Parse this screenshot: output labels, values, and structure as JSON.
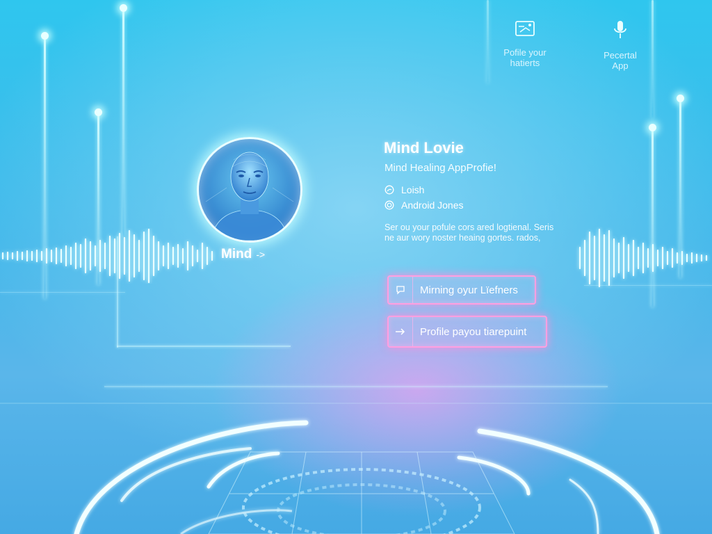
{
  "top_nav": [
    {
      "line1": "Pofile your",
      "line2": "hatierts",
      "icon": "profile-card-icon"
    },
    {
      "line1": "Pecertal",
      "line2": "App",
      "icon": "microphone-icon"
    }
  ],
  "profile": {
    "avatar": "avatar",
    "link_label": "Mind",
    "link_arrow": "->",
    "name": "Mind Lovie",
    "subtitle": "Mind Healing AppProfie!",
    "meta": [
      {
        "icon": "user-circle-icon",
        "text": "Loish"
      },
      {
        "icon": "badge-icon",
        "text": "Android Jones"
      }
    ],
    "description": "Ser ou your pofule cors ared logtienal. Seris ne aur wory noster heaing gortes. rados,"
  },
  "actions": [
    {
      "label": "Mirning oyur Lïefners",
      "icon": "chat-bubble-icon"
    },
    {
      "label": "Profile payou tiarepuint",
      "icon": "arrow-right-icon"
    }
  ],
  "colors": {
    "accent": "#ff9fe0",
    "background": "#3fbcec",
    "glow": "#eaffff"
  }
}
